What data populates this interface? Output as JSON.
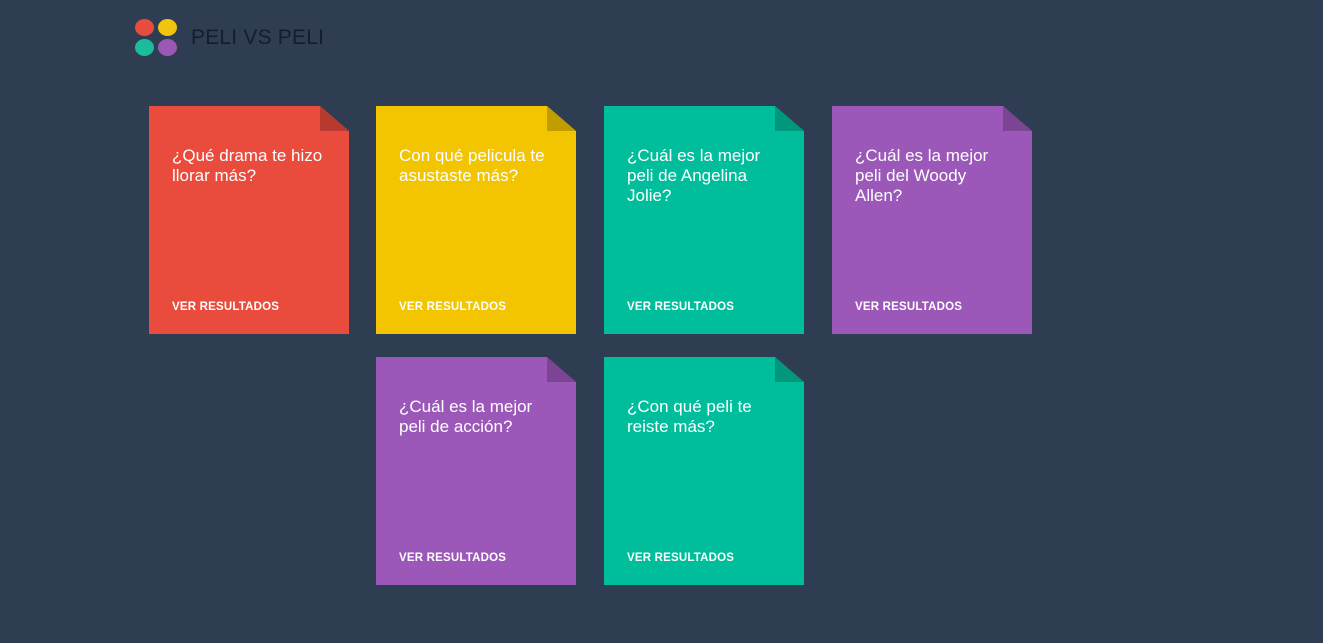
{
  "header": {
    "title": "PELI VS PELI",
    "logo_colors": [
      "#e74c3c",
      "#f1c40f",
      "#1abc9c",
      "#9b59b6"
    ]
  },
  "cards": [
    {
      "question": "¿Qué drama te hizo llorar más?",
      "link": "VER RESULTADOS",
      "color": "#e94b3c",
      "fold": "#b83a2f"
    },
    {
      "question": "Con qué pelicula te asustaste más?",
      "link": "VER RESULTADOS",
      "color": "#f2c500",
      "fold": "#c29d00"
    },
    {
      "question": "¿Cuál es la mejor peli de Angelina Jolie?",
      "link": "VER RESULTADOS",
      "color": "#00be9c",
      "fold": "#00977c"
    },
    {
      "question": "¿Cuál es la mejor peli del Woody Allen?",
      "link": "VER RESULTADOS",
      "color": "#9b58b8",
      "fold": "#7b4593"
    },
    {
      "question": "¿Cuál es la mejor peli de acción?",
      "link": "VER RESULTADOS",
      "color": "#9b58b8",
      "fold": "#7b4593"
    },
    {
      "question": "¿Con qué peli te reiste más?",
      "link": "VER RESULTADOS",
      "color": "#00be9c",
      "fold": "#00977c"
    }
  ]
}
